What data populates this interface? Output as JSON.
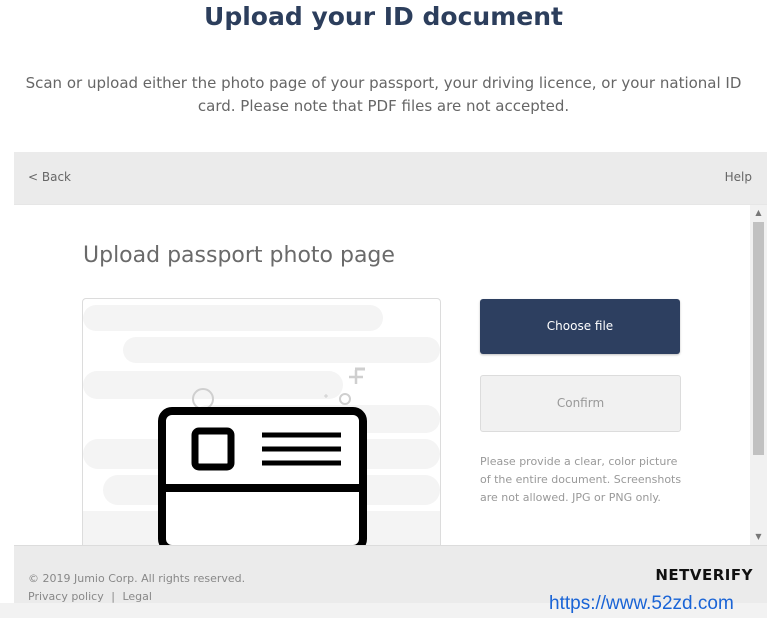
{
  "header": {
    "title": "Upload your ID document",
    "intro": "Scan or upload either the photo page of your passport, your driving licence, or your national ID card. Please note that PDF files are not accepted."
  },
  "topbar": {
    "back_label": "< Back",
    "help_label": "Help"
  },
  "main": {
    "section_title": "Upload passport photo page",
    "choose_file_label": "Choose file",
    "confirm_label": "Confirm",
    "hint": "Please provide a clear, color picture of the entire document. Screenshots are not allowed. JPG or PNG only."
  },
  "footer": {
    "copyright": "© 2019 Jumio Corp. All rights reserved.",
    "privacy_label": "Privacy policy",
    "separator": "|",
    "legal_label": "Legal",
    "brand": "NETVERIFY"
  },
  "watermark": "https://www.52zd.com",
  "colors": {
    "title": "#2c3e5c",
    "primary_button": "#2d3f60",
    "footer_bg": "#ebebeb",
    "watermark": "#1a64d6"
  },
  "icons": {
    "id_card": "id-card-icon",
    "scroll_up": "scroll-up-arrow",
    "scroll_down": "scroll-down-arrow"
  }
}
